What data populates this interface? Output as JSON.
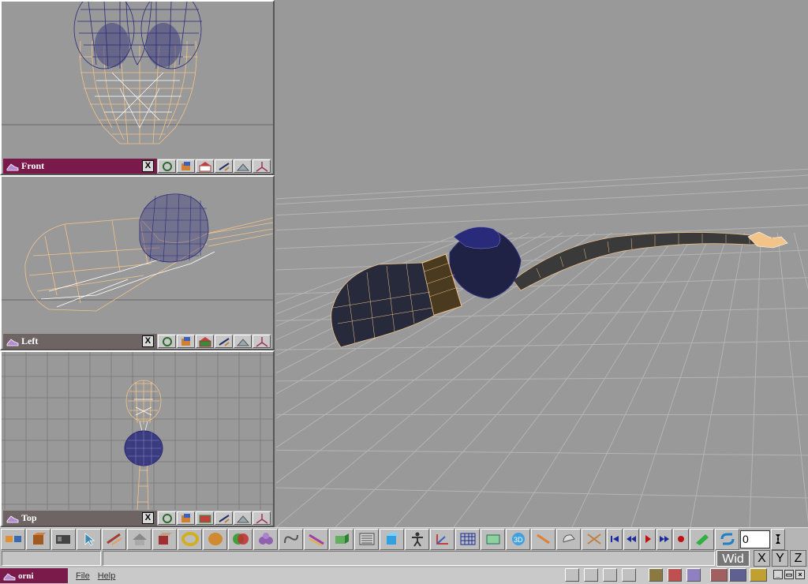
{
  "viewports": [
    {
      "label": "Front",
      "active": true
    },
    {
      "label": "Left",
      "active": false
    },
    {
      "label": "Top",
      "active": false
    }
  ],
  "viewport_close": "X",
  "frame_field": "0",
  "axis": {
    "mode": "Wid",
    "x": "X",
    "y": "Y",
    "z": "Z"
  },
  "app": {
    "name": "orni"
  },
  "menu": {
    "file": "File",
    "help": "Help"
  },
  "window_buttons": {
    "minimize": "_",
    "restore": "▭",
    "close": "×"
  },
  "colors": {
    "wire_peach": "#f2c48a",
    "wire_white": "#ffffff",
    "wire_navy": "#2a2a7a",
    "title_active": "#7a1a4a",
    "title_inactive": "#6e6464",
    "grid": "#b4b4b4"
  }
}
